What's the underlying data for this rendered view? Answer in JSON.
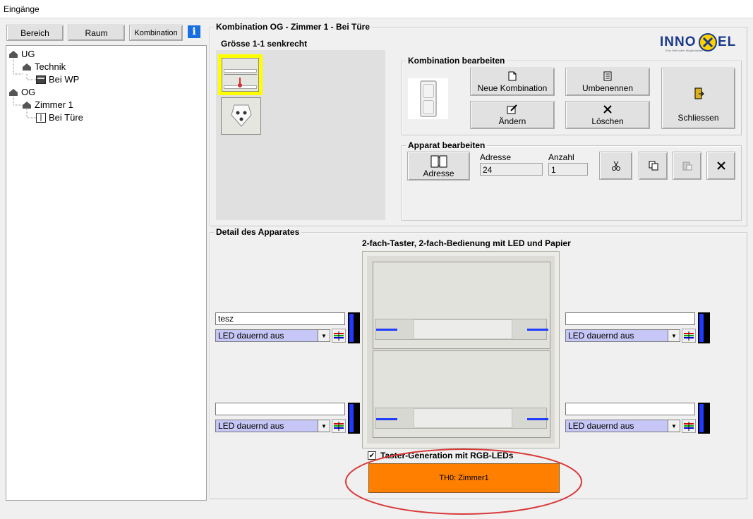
{
  "window": {
    "title": "Eingänge"
  },
  "toolbar": {
    "bereich": "Bereich",
    "raum": "Raum",
    "kombination": "Kombination",
    "info_icon": "info-icon"
  },
  "tree": {
    "ug": "UG",
    "technik": "Technik",
    "bei_wp": "Bei WP",
    "og": "OG",
    "zimmer1": "Zimmer 1",
    "bei_tuere": "Bei Türe"
  },
  "kombination_group": {
    "title": "Kombination OG - Zimmer 1 - Bei Türe",
    "size_label": "Grösse 1-1 senkrecht"
  },
  "logo": {
    "text_left": "INNO",
    "text_right": "EL",
    "tagline": "Eine Welt voller Möglichkeiten"
  },
  "kombi_bearbeiten": {
    "title": "Kombination bearbeiten",
    "neue": "Neue Kombination",
    "umbenennen": "Umbenennen",
    "aendern": "Ändern",
    "loeschen": "Löschen",
    "schliessen": "Schliessen"
  },
  "apparat_bearbeiten": {
    "title": "Apparat bearbeiten",
    "adresse_btn": "Adresse",
    "adresse_label": "Adresse",
    "adresse_value": "24",
    "anzahl_label": "Anzahl",
    "anzahl_value": "1"
  },
  "detail": {
    "title": "Detail des Apparates",
    "device_title": "2-fach-Taster, 2-fach-Bedienung mit LED und Papier",
    "left_top_text": "tesz",
    "left_top_led": "LED dauernd aus",
    "left_bottom_text": "",
    "left_bottom_led": "LED dauernd aus",
    "right_top_text": "",
    "right_top_led": "LED dauernd aus",
    "right_bottom_text": "",
    "right_bottom_led": "LED dauernd aus",
    "checkbox_label": "Taster-Generation mit RGB-LEDs",
    "checkbox_checked": true,
    "orange_button": "TH0: Zimmer1"
  },
  "colors": {
    "accent_orange": "#ff7f00",
    "highlight_yellow": "#ffff00",
    "led_blue": "#1f3cff",
    "annotation_red": "#d93a3a"
  }
}
